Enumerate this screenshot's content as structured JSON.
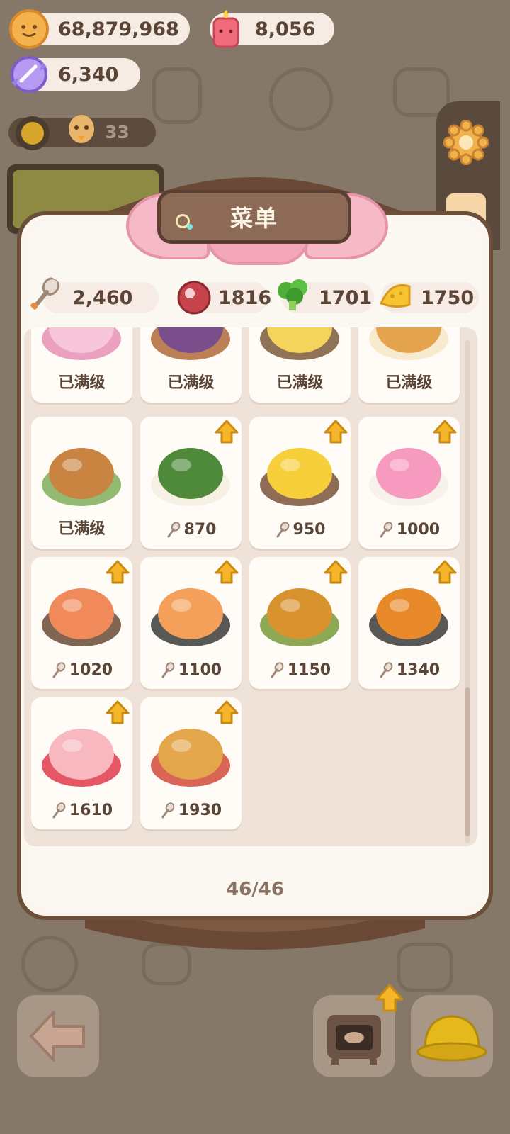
{
  "currencies": {
    "coins": "68,879,968",
    "candles": "8,056",
    "crystals": "6,340",
    "level_people": "33"
  },
  "title": "菜单",
  "resources": {
    "spoon": "2,460",
    "meat": "1816",
    "veg": "1701",
    "cheese": "1750"
  },
  "cards": [
    {
      "label": "已满级",
      "type": "maxed",
      "food": "macaron-dessert",
      "upgrade": false
    },
    {
      "label": "已满级",
      "type": "maxed",
      "food": "eel-box",
      "upgrade": false
    },
    {
      "label": "已满级",
      "type": "maxed",
      "food": "egg-bowl",
      "upgrade": false
    },
    {
      "label": "已满级",
      "type": "maxed",
      "food": "pretzel-plate",
      "upgrade": false
    },
    {
      "label": "已满级",
      "type": "maxed",
      "food": "skewers",
      "upgrade": false
    },
    {
      "label": "870",
      "type": "cost",
      "food": "zongzi",
      "upgrade": true
    },
    {
      "label": "950",
      "type": "cost",
      "food": "mango-shaved-ice",
      "upgrade": true
    },
    {
      "label": "1000",
      "type": "cost",
      "food": "jelly-cake",
      "upgrade": true
    },
    {
      "label": "1020",
      "type": "cost",
      "food": "salmon-plate",
      "upgrade": true
    },
    {
      "label": "1100",
      "type": "cost",
      "food": "shrimp-plate",
      "upgrade": true
    },
    {
      "label": "1150",
      "type": "cost",
      "food": "mooncakes",
      "upgrade": true
    },
    {
      "label": "1340",
      "type": "cost",
      "food": "roast-chicken",
      "upgrade": true
    },
    {
      "label": "1610",
      "type": "cost",
      "food": "strawberry-cake",
      "upgrade": true
    },
    {
      "label": "1930",
      "type": "cost",
      "food": "fried-chicken-bucket",
      "upgrade": true
    }
  ],
  "page": "46/46",
  "colors": {
    "panel": "#fbf6ef",
    "accent_pink": "#f6b9c7",
    "upgrade_yellow": "#f5b62a",
    "text_brown": "#5b4536"
  },
  "icons": {
    "back": "back-arrow-icon",
    "oven": "oven-icon",
    "helmet": "hard-hat-icon",
    "settings": "gear-icon"
  }
}
